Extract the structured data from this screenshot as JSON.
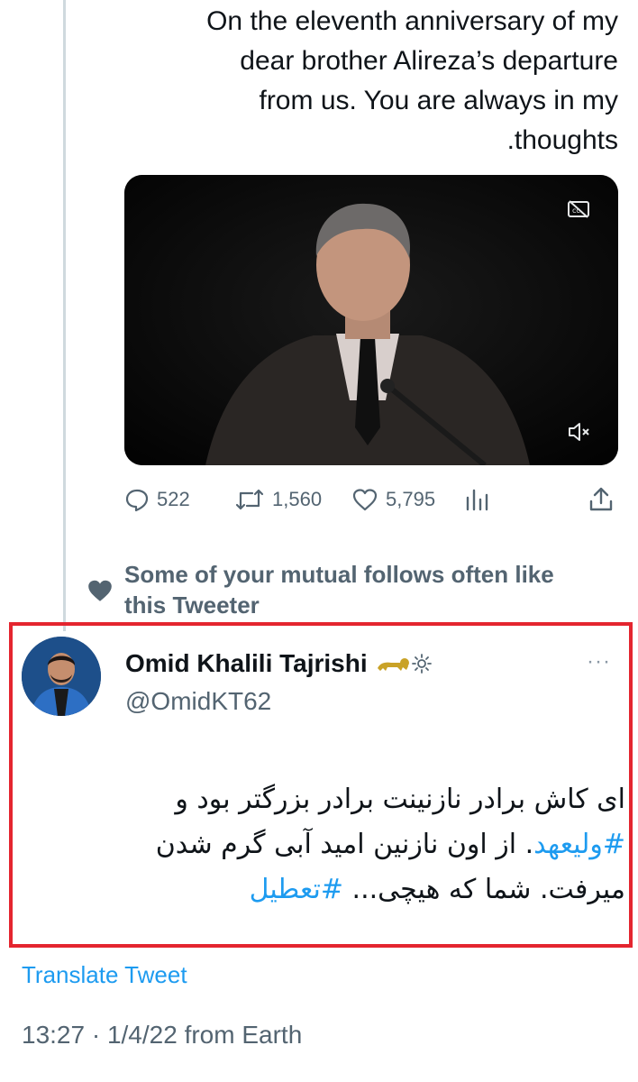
{
  "previous_tweet": {
    "text_lines": [
      "On the eleventh anniversary of my",
      "dear brother Alireza’s departure",
      "from us. You are always in my",
      ".thoughts"
    ],
    "video": {
      "captions_icon": "cc-icon",
      "mute_icon": "mute-icon"
    },
    "actions": {
      "replies": "522",
      "retweets": "1,560",
      "likes": "5,795",
      "analytics_icon": "analytics-icon",
      "share_icon": "share-icon"
    }
  },
  "social_context": {
    "icon": "heart-icon",
    "line1": "Some of your mutual follows often like",
    "line2": "this Tweeter"
  },
  "quoted_tweet": {
    "display_name": "Omid Khalili Tajrishi",
    "badges": [
      "lion-emoji",
      "sun-emoji"
    ],
    "handle": "@OmidKT62",
    "more_label": "···",
    "text": {
      "line1": "ای کاش برادر نازنینت برادر بزرگتر بود و",
      "line2_hashtag": "#ولیعهد",
      "line2_rest": ". از اون نازنین امید آبی گرم شدن",
      "line3_text": "میرفت. شما که هیچی... ",
      "line3_hashtag": "#تعطیل"
    },
    "translate_label": "Translate Tweet",
    "timestamp": "13:27 · 1/4/22 from Earth"
  },
  "colors": {
    "link": "#1d9bf0",
    "muted": "#536471",
    "highlight_border": "#e4252f"
  }
}
